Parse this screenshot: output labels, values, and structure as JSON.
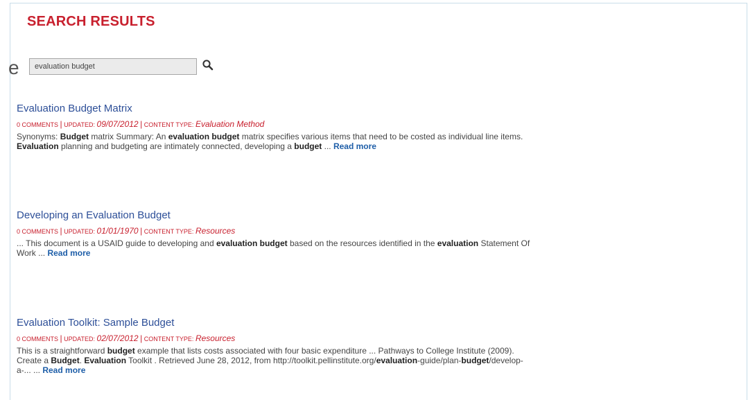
{
  "edge_char": "e",
  "heading": "SEARCH RESULTS",
  "search": {
    "value": "evaluation budget",
    "icon": "search-icon"
  },
  "meta_labels": {
    "comments": "0 COMMENTS",
    "updated": "UPDATED:",
    "content_type": "CONTENT TYPE:",
    "separator": "|"
  },
  "results": [
    {
      "title": "Evaluation Budget Matrix",
      "updated": "09/07/2012",
      "content_type": "Evaluation Method",
      "snippet": [
        {
          "t": "Synonyms:  "
        },
        {
          "b": "Budget"
        },
        {
          "t": " matrix Summary:  An "
        },
        {
          "b": "evaluation budget"
        },
        {
          "t": " matrix specifies various items that need to be costed as individual line items."
        },
        {
          "br": true
        },
        {
          "b": "Evaluation"
        },
        {
          "t": " planning and budgeting are intimately connected, developing a "
        },
        {
          "b": "budget"
        },
        {
          "t": " ... "
        }
      ],
      "read_more": "Read more"
    },
    {
      "title": "Developing an Evaluation Budget",
      "updated": "01/01/1970",
      "content_type": "Resources",
      "snippet": [
        {
          "t": "... This document is a USAID guide to developing and "
        },
        {
          "b": "evaluation budget"
        },
        {
          "t": " based on the resources identified in the "
        },
        {
          "b": "evaluation"
        },
        {
          "t": " Statement Of"
        },
        {
          "br": true
        },
        {
          "t": "Work ... "
        }
      ],
      "read_more": "Read more"
    },
    {
      "title": "Evaluation Toolkit: Sample Budget",
      "updated": "02/07/2012",
      "content_type": "Resources",
      "snippet": [
        {
          "t": "This is a straightforward "
        },
        {
          "b": "budget"
        },
        {
          "t": " example that lists costs associated with four basic expenditure ... Pathways to College Institute (2009)."
        },
        {
          "br": true
        },
        {
          "t": "Create a "
        },
        {
          "b": "Budget"
        },
        {
          "t": ".  "
        },
        {
          "b": "Evaluation"
        },
        {
          "t": " Toolkit . Retrieved June 28, 2012, from http://toolkit.pellinstitute.org/"
        },
        {
          "b": "evaluation"
        },
        {
          "t": "-guide/plan-"
        },
        {
          "b": "budget"
        },
        {
          "t": "/develop-"
        },
        {
          "br": true
        },
        {
          "t": "a-... ... "
        }
      ],
      "read_more": "Read more"
    }
  ]
}
